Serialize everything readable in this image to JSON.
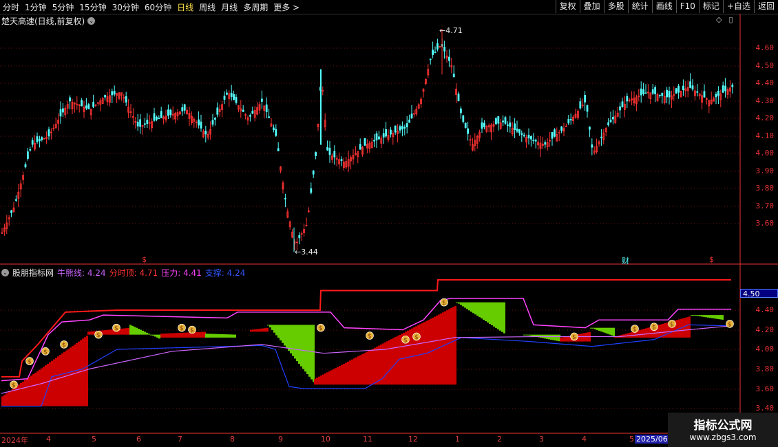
{
  "toolbar": {
    "periods": [
      "分时",
      "1分钟",
      "5分钟",
      "15分钟",
      "30分钟",
      "60分钟",
      "日线",
      "周线",
      "月线",
      "多周期",
      "更多"
    ],
    "active_period": "日线",
    "more_arrow": ">",
    "right_buttons": [
      "复权",
      "叠加",
      "多股",
      "统计",
      "画线",
      "F10",
      "标记",
      "+自选",
      "返回"
    ]
  },
  "main_chart": {
    "title": "楚天高速(日线,前复权)",
    "title_icon": "chevron-down-icon",
    "high_label": "4.71",
    "low_label": "3.44",
    "y_ticks": [
      "4.60",
      "4.50",
      "4.40",
      "4.30",
      "4.20",
      "4.10",
      "4.00",
      "3.90",
      "3.80",
      "3.70",
      "3.60"
    ],
    "markers": [
      "$",
      "财",
      "$"
    ]
  },
  "indicator": {
    "name": "股朋指标网",
    "fields": [
      {
        "label": "牛熊线:",
        "value": "4.24",
        "color": "#cc66ff"
      },
      {
        "label": "分时顶:",
        "value": "4.71",
        "color": "#ff3333"
      },
      {
        "label": "压力:",
        "value": "4.41",
        "color": "#ff44ff"
      },
      {
        "label": "支撑:",
        "value": "4.24",
        "color": "#3355ff"
      }
    ],
    "y_ticks": [
      "4.40",
      "4.20",
      "4.00",
      "3.80",
      "3.60",
      "3.40"
    ],
    "price_box": "4.50"
  },
  "date_axis": [
    "2024年",
    "4",
    "5",
    "6",
    "7",
    "8",
    "9",
    "10",
    "11",
    "12",
    "1",
    "2",
    "3",
    "4",
    "5",
    "2025/06/"
  ],
  "watermark": {
    "line1": "指标公式网",
    "line2": "www.zbgs3.com"
  },
  "colors": {
    "up": "#ff3333",
    "down": "#54ffff",
    "bull": "#cc0000",
    "bear": "#66cc00",
    "support": "#2040ff",
    "resistance": "#ff44ff",
    "top": "#ff1a1a"
  },
  "chart_data": {
    "type": "candlestick",
    "title": "楚天高速(日线,前复权)",
    "ylim": [
      3.44,
      4.71
    ],
    "high": 4.71,
    "low": 3.44,
    "indicator": {
      "牛熊线": 4.24,
      "分时顶": 4.71,
      "压力": 4.41,
      "支撑": 4.24
    }
  }
}
